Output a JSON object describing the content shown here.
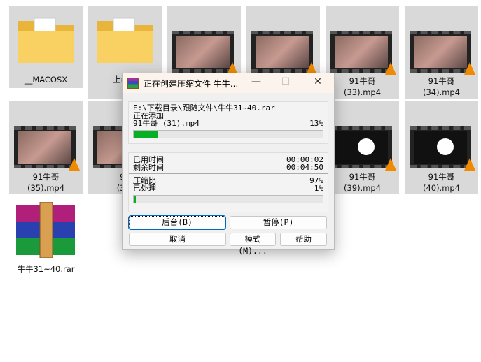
{
  "files": [
    {
      "name": "__MACOSX",
      "type": "folder"
    },
    {
      "name": "上老王",
      "type": "folder"
    },
    {
      "name": "",
      "type": "video"
    },
    {
      "name": "",
      "type": "video"
    },
    {
      "name": "91牛哥\n(33).mp4",
      "type": "video"
    },
    {
      "name": "91牛哥\n(34).mp4",
      "type": "video"
    },
    {
      "name": "91牛哥\n(35).mp4",
      "type": "video"
    },
    {
      "name": "91\n(36)",
      "type": "video"
    },
    {
      "name": "",
      "type": "video"
    },
    {
      "name": "",
      "type": "video"
    },
    {
      "name": "91牛哥\n(39).mp4",
      "type": "video-dark"
    },
    {
      "name": "91牛哥\n(40).mp4",
      "type": "video-dark"
    },
    {
      "name": "牛牛31~40.rar",
      "type": "rar"
    }
  ],
  "dialog": {
    "title": "正在创建压缩文件 牛牛...",
    "archive_path": "E:\\下载目录\\跟随文件\\牛牛31~40.rar",
    "status": "正在添加",
    "current_file": "91牛哥 (31).mp4",
    "file_percent_label": "13%",
    "file_progress": 13,
    "elapsed_label": "已用时间",
    "elapsed": "00:00:02",
    "remaining_label": "剩余时间",
    "remaining": "00:04:50",
    "ratio_label": "压缩比",
    "ratio": "97%",
    "processed_label": "已处理",
    "processed": "1%",
    "total_progress": 1,
    "buttons": {
      "background": "后台(B)",
      "pause": "暂停(P)",
      "cancel": "取消",
      "mode": "模式(M)...",
      "help": "帮助"
    }
  },
  "colors": {
    "progress": "#06b025"
  }
}
